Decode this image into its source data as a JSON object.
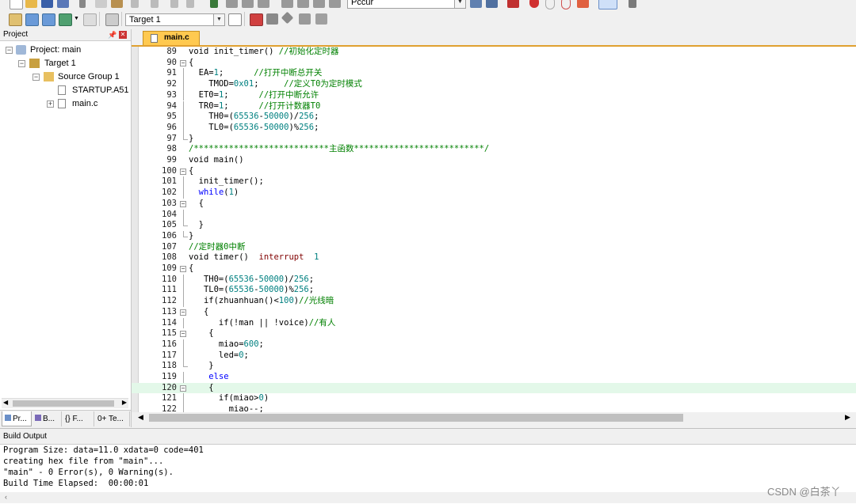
{
  "toolbar": {
    "target_combo": "Target 1",
    "top_combo": "Pccur"
  },
  "project_panel": {
    "title": "Project",
    "pin_icon": "pin-icon",
    "close_icon": "close-icon",
    "tree": [
      {
        "label": "Project: main",
        "icon": "project-icon",
        "toggle": "−"
      },
      {
        "label": "Target 1",
        "icon": "target-icon",
        "toggle": "−"
      },
      {
        "label": "Source Group 1",
        "icon": "folder-icon",
        "toggle": "−"
      },
      {
        "label": "STARTUP.A51",
        "icon": "file-icon",
        "toggle": ""
      },
      {
        "label": "main.c",
        "icon": "file-icon",
        "toggle": "+"
      }
    ],
    "tabs": [
      {
        "label": "Pr...",
        "icon": "project-tab-icon"
      },
      {
        "label": "B...",
        "icon": "books-tab-icon"
      },
      {
        "label": "{} F...",
        "icon": "functions-tab-icon"
      },
      {
        "label": "0+ Te...",
        "icon": "templates-tab-icon"
      }
    ]
  },
  "editor": {
    "tab_label": "main.c",
    "lines": [
      {
        "n": "89",
        "fold": "",
        "t": [
          [
            "void init_timer() ",
            ""
          ],
          [
            "//初始化定时器",
            "cm"
          ]
        ]
      },
      {
        "n": "90",
        "fold": "−",
        "t": [
          [
            "{",
            ""
          ]
        ]
      },
      {
        "n": "91",
        "fold": "|",
        "t": [
          [
            "  EA=",
            ""
          ],
          [
            "1",
            "num"
          ],
          [
            ";      ",
            ""
          ],
          [
            "//打开中断总开关",
            "cm"
          ]
        ]
      },
      {
        "n": "92",
        "fold": "|",
        "t": [
          [
            "    TMOD=",
            ""
          ],
          [
            "0x01",
            "num"
          ],
          [
            ";     ",
            ""
          ],
          [
            "//定义T0为定时模式",
            "cm"
          ]
        ]
      },
      {
        "n": "93",
        "fold": "|",
        "t": [
          [
            "  ET0=",
            ""
          ],
          [
            "1",
            "num"
          ],
          [
            ";      ",
            ""
          ],
          [
            "//打开中断允许",
            "cm"
          ]
        ]
      },
      {
        "n": "94",
        "fold": "|",
        "t": [
          [
            "  TR0=",
            ""
          ],
          [
            "1",
            "num"
          ],
          [
            ";      ",
            ""
          ],
          [
            "//打开计数器T0",
            "cm"
          ]
        ]
      },
      {
        "n": "95",
        "fold": "|",
        "t": [
          [
            "    TH0=(",
            ""
          ],
          [
            "65536",
            "num"
          ],
          [
            "-",
            ""
          ],
          [
            "50000",
            "num"
          ],
          [
            ")/",
            ""
          ],
          [
            "256",
            "num"
          ],
          [
            ";",
            ""
          ]
        ]
      },
      {
        "n": "96",
        "fold": "|",
        "t": [
          [
            "    TL0=(",
            ""
          ],
          [
            "65536",
            "num"
          ],
          [
            "-",
            ""
          ],
          [
            "50000",
            "num"
          ],
          [
            ")%",
            ""
          ],
          [
            "256",
            "num"
          ],
          [
            ";",
            ""
          ]
        ]
      },
      {
        "n": "97",
        "fold": "L",
        "t": [
          [
            "}",
            ""
          ]
        ]
      },
      {
        "n": "98",
        "fold": "",
        "t": [
          [
            "/***************************主函数**************************/",
            "cm"
          ]
        ]
      },
      {
        "n": "99",
        "fold": "",
        "t": [
          [
            "void main()",
            ""
          ]
        ]
      },
      {
        "n": "100",
        "fold": "−",
        "t": [
          [
            "{",
            ""
          ]
        ]
      },
      {
        "n": "101",
        "fold": "|",
        "t": [
          [
            "  init_timer();",
            ""
          ]
        ]
      },
      {
        "n": "102",
        "fold": "|",
        "t": [
          [
            "  ",
            ""
          ],
          [
            "while",
            "kw"
          ],
          [
            "(",
            ""
          ],
          [
            "1",
            "num"
          ],
          [
            ")",
            ""
          ]
        ]
      },
      {
        "n": "103",
        "fold": "−",
        "t": [
          [
            "  {",
            ""
          ]
        ]
      },
      {
        "n": "104",
        "fold": "|",
        "t": [
          [
            "",
            ""
          ]
        ]
      },
      {
        "n": "105",
        "fold": "L",
        "t": [
          [
            "  }",
            ""
          ]
        ]
      },
      {
        "n": "106",
        "fold": "L",
        "t": [
          [
            "}",
            ""
          ]
        ]
      },
      {
        "n": "107",
        "fold": "",
        "t": [
          [
            "//定时器0中断",
            "cm"
          ]
        ]
      },
      {
        "n": "108",
        "fold": "",
        "t": [
          [
            "void timer()  ",
            ""
          ],
          [
            "interrupt",
            "ir"
          ],
          [
            "  ",
            ""
          ],
          [
            "1",
            "num"
          ]
        ]
      },
      {
        "n": "109",
        "fold": "−",
        "t": [
          [
            "{",
            ""
          ]
        ]
      },
      {
        "n": "110",
        "fold": "|",
        "t": [
          [
            "   TH0=(",
            ""
          ],
          [
            "65536",
            "num"
          ],
          [
            "-",
            ""
          ],
          [
            "50000",
            "num"
          ],
          [
            ")/",
            ""
          ],
          [
            "256",
            "num"
          ],
          [
            ";",
            ""
          ]
        ]
      },
      {
        "n": "111",
        "fold": "|",
        "t": [
          [
            "   TL0=(",
            ""
          ],
          [
            "65536",
            "num"
          ],
          [
            "-",
            ""
          ],
          [
            "50000",
            "num"
          ],
          [
            ")%",
            ""
          ],
          [
            "256",
            "num"
          ],
          [
            ";",
            ""
          ]
        ]
      },
      {
        "n": "112",
        "fold": "|",
        "t": [
          [
            "   if(zhuanhuan()<",
            ""
          ],
          [
            "100",
            "num"
          ],
          [
            ")",
            ""
          ],
          [
            "//光线暗",
            "cm"
          ]
        ]
      },
      {
        "n": "113",
        "fold": "−",
        "t": [
          [
            "   {",
            ""
          ]
        ]
      },
      {
        "n": "114",
        "fold": "|",
        "t": [
          [
            "      if(!man || !voice)",
            ""
          ],
          [
            "//有人",
            "cm"
          ]
        ]
      },
      {
        "n": "115",
        "fold": "−",
        "t": [
          [
            "    {",
            ""
          ]
        ]
      },
      {
        "n": "116",
        "fold": "|",
        "t": [
          [
            "      miao=",
            ""
          ],
          [
            "600",
            "num"
          ],
          [
            ";",
            ""
          ]
        ]
      },
      {
        "n": "117",
        "fold": "|",
        "t": [
          [
            "      led=",
            ""
          ],
          [
            "0",
            "num"
          ],
          [
            ";",
            ""
          ]
        ]
      },
      {
        "n": "118",
        "fold": "L",
        "t": [
          [
            "    }",
            ""
          ]
        ]
      },
      {
        "n": "119",
        "fold": "|",
        "t": [
          [
            "    ",
            ""
          ],
          [
            "else",
            "kw"
          ]
        ]
      },
      {
        "n": "120",
        "fold": "−",
        "hl": true,
        "t": [
          [
            "    {",
            ""
          ]
        ]
      },
      {
        "n": "121",
        "fold": "|",
        "t": [
          [
            "      if(miao>",
            ""
          ],
          [
            "0",
            "num"
          ],
          [
            ")",
            ""
          ]
        ]
      },
      {
        "n": "122",
        "fold": "|",
        "t": [
          [
            "        miao--;",
            ""
          ]
        ]
      }
    ]
  },
  "build_output": {
    "title": "Build Output",
    "lines": [
      "Program Size: data=11.0 xdata=0 code=401",
      "creating hex file from \"main\"...",
      "\"main\" - 0 Error(s), 0 Warning(s).",
      "Build Time Elapsed:  00:00:01"
    ]
  },
  "watermark": "CSDN @白茶丫"
}
